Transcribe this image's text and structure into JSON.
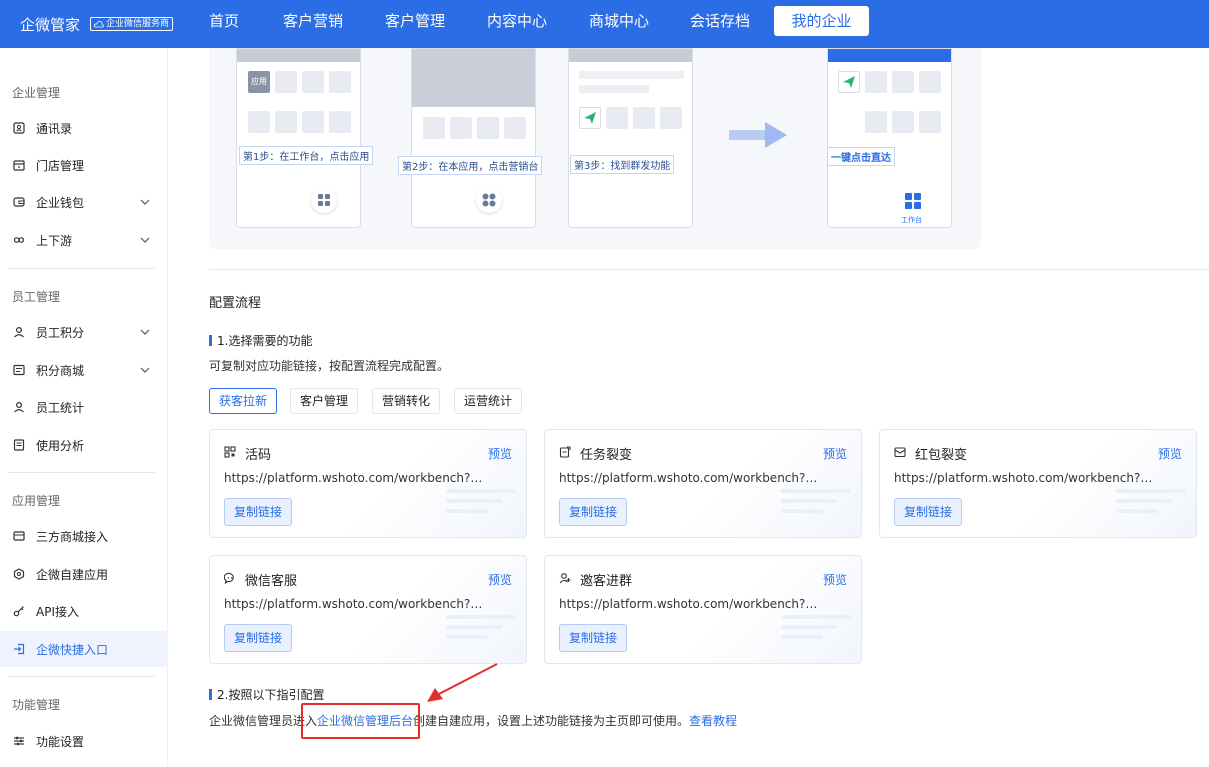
{
  "brand": {
    "name": "企微管家",
    "badge": "企业微信服务商"
  },
  "nav": [
    "首页",
    "客户营销",
    "客户管理",
    "内容中心",
    "商城中心",
    "会话存档",
    "我的企业"
  ],
  "sidebar": {
    "sections": [
      {
        "title": "企业管理",
        "items": [
          "通讯录",
          "门店管理",
          "企业钱包",
          "上下游"
        ]
      },
      {
        "title": "员工管理",
        "items": [
          "员工积分",
          "积分商城",
          "员工统计",
          "使用分析"
        ]
      },
      {
        "title": "应用管理",
        "items": [
          "三方商城接入",
          "企微自建应用",
          "API接入",
          "企微快捷入口"
        ]
      },
      {
        "title": "功能管理",
        "items": [
          "功能设置"
        ]
      }
    ],
    "active_item": "企微快捷入口"
  },
  "illustration": {
    "steps": [
      "第1步：在工作台，点击应用",
      "第2步：在本应用，点击营销台",
      "第3步：找到群发功能",
      "一键点击直达"
    ],
    "app_tile": "应用",
    "tab_label": "工作台"
  },
  "config": {
    "heading": "配置流程",
    "step1": "1.选择需要的功能",
    "step1_desc": "可复制对应功能链接，按配置流程完成配置。",
    "tabs": [
      "获客拉新",
      "客户管理",
      "营销转化",
      "运营统计"
    ],
    "active_tab": "获客拉新",
    "cards": [
      {
        "title": "活码",
        "icon": "qrcode-icon",
        "preview": "预览",
        "url": "https://platform.wshoto.com/workbench?cid…",
        "copy": "复制链接"
      },
      {
        "title": "任务裂变",
        "icon": "task-icon",
        "preview": "预览",
        "url": "https://platform.wshoto.com/workbench?cid…",
        "copy": "复制链接"
      },
      {
        "title": "红包裂变",
        "icon": "red-packet-icon",
        "preview": "预览",
        "url": "https://platform.wshoto.com/workbench?cid…",
        "copy": "复制链接"
      },
      {
        "title": "微信客服",
        "icon": "chat-icon",
        "preview": "预览",
        "url": "https://platform.wshoto.com/workbench?cid…",
        "copy": "复制链接"
      },
      {
        "title": "邀客进群",
        "icon": "invite-icon",
        "preview": "预览",
        "url": "https://platform.wshoto.com/workbench?cid…",
        "copy": "复制链接"
      }
    ],
    "step2": "2.按照以下指引配置",
    "guide_prefix": "企业微信管理员进入",
    "guide_link": "企业微信管理后台",
    "guide_suffix": "创建自建应用，设置上述功能链接为主页即可使用。",
    "guide_tutorial": "查看教程"
  },
  "colors": {
    "primary": "#2b6de5",
    "annotation": "#e0302a"
  }
}
